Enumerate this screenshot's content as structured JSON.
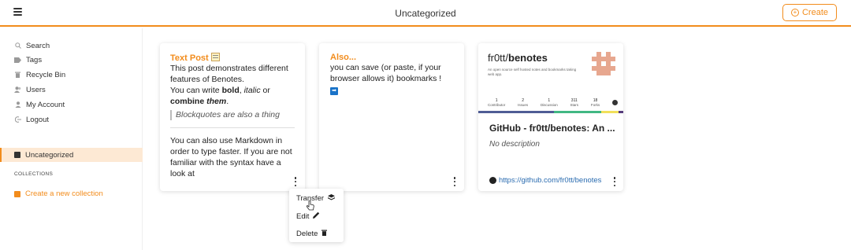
{
  "header": {
    "title": "Uncategorized",
    "create_label": "Create"
  },
  "sidebar": {
    "items": [
      {
        "label": "Search",
        "icon": "search-icon"
      },
      {
        "label": "Tags",
        "icon": "tag-icon"
      },
      {
        "label": "Recycle Bin",
        "icon": "trash-icon"
      },
      {
        "label": "Users",
        "icon": "users-icon"
      },
      {
        "label": "My Account",
        "icon": "user-icon"
      },
      {
        "label": "Logout",
        "icon": "logout-icon"
      }
    ],
    "active_collection": "Uncategorized",
    "collections_heading": "COLLECTIONS",
    "new_collection_label": "Create a new collection"
  },
  "cards": {
    "text_post": {
      "title": "Text Post",
      "line1": "This post demonstrates different features of Benotes.",
      "line2_a": "You can write ",
      "line2_bold": "bold",
      "line2_b": ", ",
      "line2_italic": "italic",
      "line2_c": " or",
      "line3_a": "combine ",
      "line3_bi": "them",
      "line3_b": ".",
      "quote": "Blockquotes are also a thing",
      "footer": "You can also use Markdown in order to type faster. If you are not familiar with the syntax have a look at"
    },
    "also": {
      "title": "Also...",
      "body": "you can save (or paste, if your browser allows it) bookmarks !"
    },
    "github": {
      "repo_owner": "fr0tt/",
      "repo_name": "benotes",
      "preview_desc": "An open source self hosted notes and bookmarks taking web app.",
      "stats": [
        {
          "n": "1",
          "label": "Contributor"
        },
        {
          "n": "2",
          "label": "Issues"
        },
        {
          "n": "1",
          "label": "Discussion"
        },
        {
          "n": "311",
          "label": "Stars"
        },
        {
          "n": "18",
          "label": "Forks"
        }
      ],
      "title": "GitHub - fr0tt/benotes: An ...",
      "description": "No description",
      "url": "https://github.com/fr0tt/benotes",
      "language_colors": [
        "#4f5d95",
        "#41b883",
        "#f1e05a",
        "#563d7c"
      ]
    }
  },
  "context_menu": {
    "transfer_label": "Transfer",
    "edit_label": "Edit",
    "delete_label": "Delete"
  },
  "colors": {
    "accent": "#f28c1c",
    "link": "#2b6cb0"
  }
}
